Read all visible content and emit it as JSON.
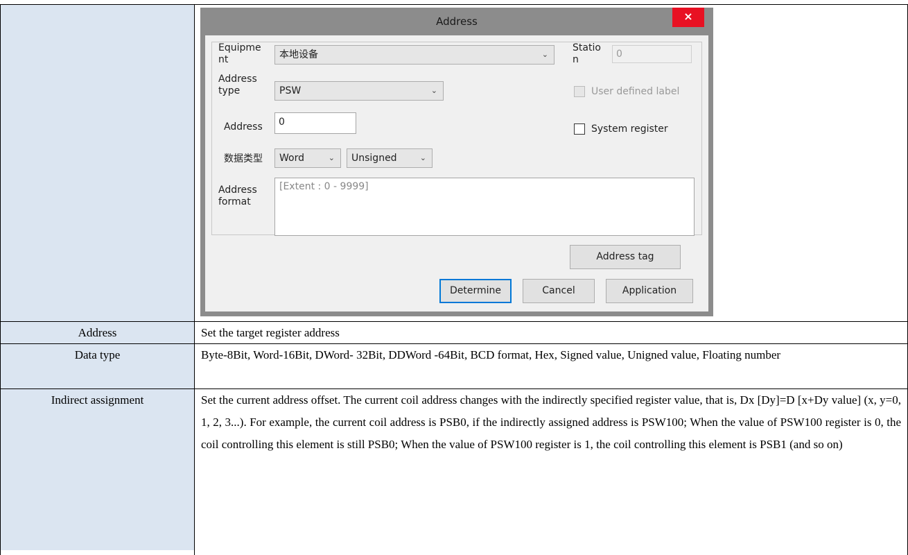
{
  "dialog": {
    "title": "Address",
    "close_label": "×",
    "equipment": {
      "label_line1": "Equipme",
      "label_line2": "nt",
      "value": "本地设备"
    },
    "station": {
      "label_line1": "Statio",
      "label_line2": "n",
      "value": "0"
    },
    "address_type": {
      "label_line1": "Address",
      "label_line2": "type",
      "value": "PSW"
    },
    "user_defined_label": {
      "label": "User defined label",
      "checked": false,
      "enabled": false
    },
    "address": {
      "label": "Address",
      "value": "0"
    },
    "system_register": {
      "label": "System register",
      "checked": false
    },
    "data_type": {
      "label": "数据类型",
      "word_value": "Word",
      "sign_value": "Unsigned"
    },
    "address_format": {
      "label_line1": "Address",
      "label_line2": "format",
      "value": "[Extent : 0 - 9999]"
    },
    "buttons": {
      "address_tag": "Address tag",
      "determine": "Determine",
      "cancel": "Cancel",
      "application": "Application"
    },
    "chevron": "⌄"
  },
  "rows": [
    {
      "label": "Address",
      "description": "Set the target register address"
    },
    {
      "label": "Data type",
      "description": "Byte-8Bit, Word-16Bit, DWord- 32Bit, DDWord -64Bit, BCD format, Hex, Signed value, Unigned value, Floating number"
    },
    {
      "label": "Indirect assignment",
      "description": "Set the current address offset. The current coil address changes with the indirectly specified register value, that is, Dx [Dy]=D [x+Dy value] (x, y=0, 1, 2, 3...). For example, the current coil address is PSB0, if the indirectly assigned address is PSW100; When the value of PSW100 register is 0, the coil controlling this element is still PSB0; When the value of PSW100 register is 1, the coil controlling this element is PSB1 (and so on)"
    }
  ],
  "colors": {
    "label_bg": "#dbe5f1",
    "dialog_frame": "#8c8c8c",
    "close_red": "#e81123",
    "default_button_border": "#0078d7"
  }
}
